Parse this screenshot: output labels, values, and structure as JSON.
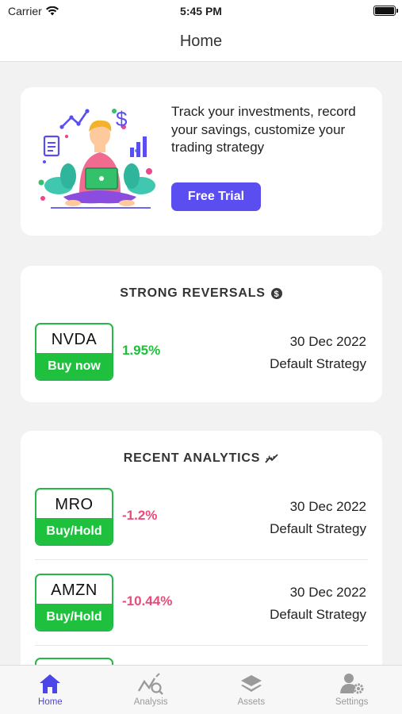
{
  "status_bar": {
    "carrier": "Carrier",
    "time": "5:45 PM"
  },
  "nav": {
    "title": "Home"
  },
  "promo": {
    "text": "Track your investments, record your savings, customize your trading strategy",
    "button": "Free Trial"
  },
  "strong_reversals": {
    "title": "STRONG REVERSALS",
    "items": [
      {
        "symbol": "NVDA",
        "action": "Buy now",
        "change": "1.95%",
        "date": "30 Dec 2022",
        "strategy": "Default Strategy"
      }
    ]
  },
  "recent_analytics": {
    "title": "RECENT ANALYTICS",
    "items": [
      {
        "symbol": "MRO",
        "action": "Buy/Hold",
        "change": "-1.2%",
        "date": "30 Dec 2022",
        "strategy": "Default Strategy"
      },
      {
        "symbol": "AMZN",
        "action": "Buy/Hold",
        "change": "-10.44%",
        "date": "30 Dec 2022",
        "strategy": "Default Strategy"
      }
    ]
  },
  "tabs": [
    {
      "label": "Home",
      "icon": "home-icon",
      "active": true
    },
    {
      "label": "Analysis",
      "icon": "analysis-icon",
      "active": false
    },
    {
      "label": "Assets",
      "icon": "layers-icon",
      "active": false
    },
    {
      "label": "Settings",
      "icon": "user-settings-icon",
      "active": false
    }
  ],
  "colors": {
    "accent": "#5b4ef0",
    "buy_green": "#1ec03e",
    "gain": "#1fbf3d",
    "loss": "#ea4b79",
    "tab_active": "#4a46e8"
  }
}
